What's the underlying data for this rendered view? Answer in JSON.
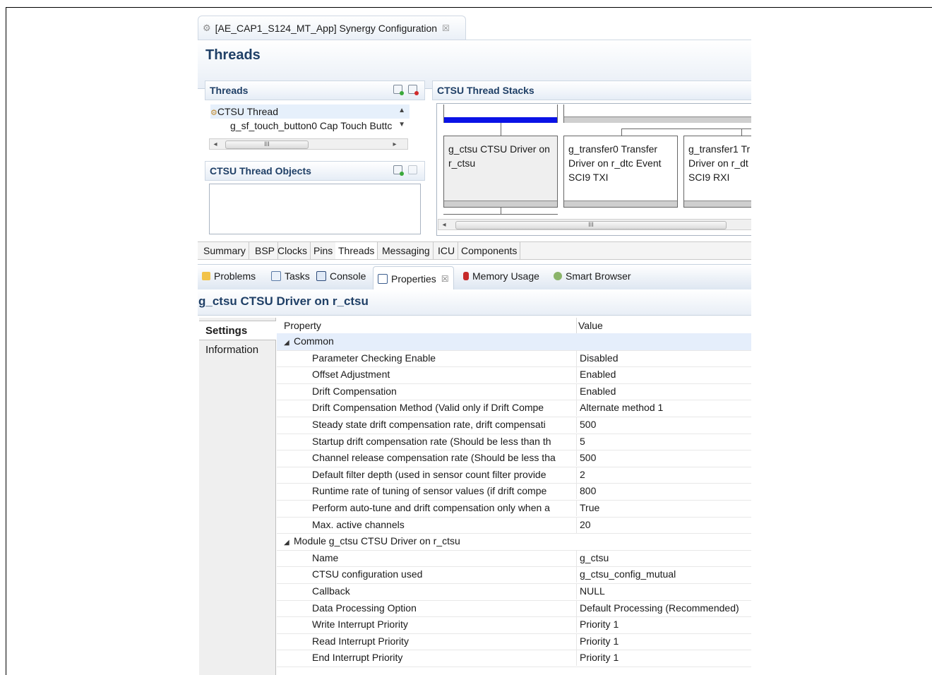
{
  "editor": {
    "tab_title": "[AE_CAP1_S124_MT_App] Synergy Configuration",
    "close_glyph": "☒",
    "page_title": "Threads"
  },
  "threads_panel": {
    "title": "Threads",
    "items": [
      "CTSU Thread",
      "g_sf_touch_button0 Cap Touch Buttc"
    ]
  },
  "objects_panel": {
    "title": "CTSU Thread Objects"
  },
  "stacks_panel": {
    "title": "CTSU Thread Stacks",
    "cards": [
      {
        "line1": "g_ctsu CTSU Driver on",
        "line2": "r_ctsu",
        "line3": ""
      },
      {
        "line1": "g_transfer0 Transfer",
        "line2": "Driver on r_dtc Event",
        "line3": "SCI9 TXI"
      },
      {
        "line1": "g_transfer1 Tr",
        "line2": "Driver on r_dt",
        "line3": "SCI9 RXI"
      }
    ],
    "scroll_glyph": "III"
  },
  "editor_tabs": [
    "Summary",
    "BSP",
    "Clocks",
    "Pins",
    "Threads",
    "Messaging",
    "ICU",
    "Components"
  ],
  "view_tabs": [
    "Problems",
    "Tasks",
    "Console",
    "Properties",
    "Memory Usage",
    "Smart Browser"
  ],
  "properties": {
    "title": "g_ctsu CTSU Driver on r_ctsu",
    "side_tabs": [
      "Settings",
      "Information"
    ],
    "col_property": "Property",
    "col_value": "Value",
    "rows": [
      {
        "p": "Common",
        "v": "",
        "group": true
      },
      {
        "p": "Parameter Checking Enable",
        "v": "Disabled"
      },
      {
        "p": "Offset Adjustment",
        "v": "Enabled"
      },
      {
        "p": "Drift Compensation",
        "v": "Enabled"
      },
      {
        "p": "Drift Compensation Method (Valid only if Drift Compe",
        "v": "Alternate method 1"
      },
      {
        "p": "Steady state drift compensation rate, drift compensati",
        "v": "500"
      },
      {
        "p": "Startup drift compensation rate (Should be less than th",
        "v": "5"
      },
      {
        "p": "Channel release compensation rate (Should be less tha",
        "v": "500"
      },
      {
        "p": "Default filter depth (used in sensor count filter provide",
        "v": "2"
      },
      {
        "p": "Runtime rate of tuning of sensor values (if drift compe",
        "v": "800"
      },
      {
        "p": "Perform auto-tune and drift compensation only when a",
        "v": "True"
      },
      {
        "p": "Max. active channels",
        "v": "20"
      },
      {
        "p": "Module g_ctsu CTSU Driver on r_ctsu",
        "v": "",
        "group": true
      },
      {
        "p": "Name",
        "v": "g_ctsu"
      },
      {
        "p": "CTSU configuration used",
        "v": "g_ctsu_config_mutual"
      },
      {
        "p": "Callback",
        "v": "NULL"
      },
      {
        "p": "Data Processing Option",
        "v": "Default Processing (Recommended)"
      },
      {
        "p": "Write Interrupt Priority",
        "v": "Priority 1"
      },
      {
        "p": "Read Interrupt Priority",
        "v": "Priority 1"
      },
      {
        "p": "End Interrupt Priority",
        "v": "Priority 1"
      }
    ]
  },
  "colors": {
    "accent_title": "#1f3f66",
    "stack_highlight": "#0a12e6"
  }
}
